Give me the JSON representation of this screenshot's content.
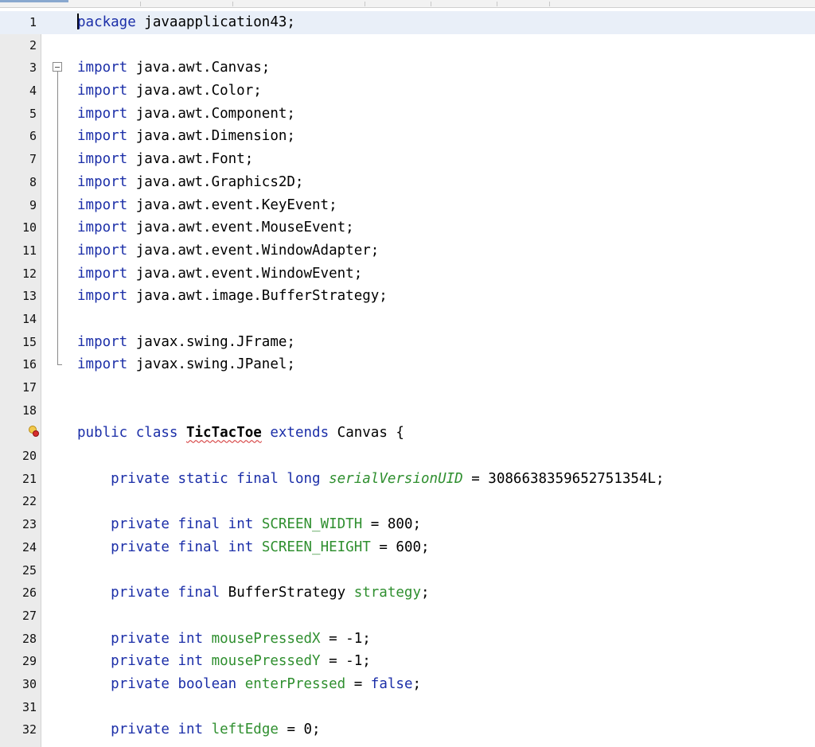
{
  "editor": {
    "lines": [
      {
        "n": "1",
        "parts": [
          {
            "t": "package",
            "c": "kw"
          },
          {
            "t": " javaapplication43;",
            "c": ""
          }
        ]
      },
      {
        "n": "2",
        "parts": []
      },
      {
        "n": "3",
        "parts": [
          {
            "t": "import",
            "c": "kw"
          },
          {
            "t": " java.awt.Canvas;",
            "c": ""
          }
        ]
      },
      {
        "n": "4",
        "parts": [
          {
            "t": "import",
            "c": "kw"
          },
          {
            "t": " java.awt.Color;",
            "c": ""
          }
        ]
      },
      {
        "n": "5",
        "parts": [
          {
            "t": "import",
            "c": "kw"
          },
          {
            "t": " java.awt.Component;",
            "c": ""
          }
        ]
      },
      {
        "n": "6",
        "parts": [
          {
            "t": "import",
            "c": "kw"
          },
          {
            "t": " java.awt.Dimension;",
            "c": ""
          }
        ]
      },
      {
        "n": "7",
        "parts": [
          {
            "t": "import",
            "c": "kw"
          },
          {
            "t": " java.awt.Font;",
            "c": ""
          }
        ]
      },
      {
        "n": "8",
        "parts": [
          {
            "t": "import",
            "c": "kw"
          },
          {
            "t": " java.awt.Graphics2D;",
            "c": ""
          }
        ]
      },
      {
        "n": "9",
        "parts": [
          {
            "t": "import",
            "c": "kw"
          },
          {
            "t": " java.awt.event.KeyEvent;",
            "c": ""
          }
        ]
      },
      {
        "n": "10",
        "parts": [
          {
            "t": "import",
            "c": "kw"
          },
          {
            "t": " java.awt.event.MouseEvent;",
            "c": ""
          }
        ]
      },
      {
        "n": "11",
        "parts": [
          {
            "t": "import",
            "c": "kw"
          },
          {
            "t": " java.awt.event.WindowAdapter;",
            "c": ""
          }
        ]
      },
      {
        "n": "12",
        "parts": [
          {
            "t": "import",
            "c": "kw"
          },
          {
            "t": " java.awt.event.WindowEvent;",
            "c": ""
          }
        ]
      },
      {
        "n": "13",
        "parts": [
          {
            "t": "import",
            "c": "kw"
          },
          {
            "t": " java.awt.image.BufferStrategy;",
            "c": ""
          }
        ]
      },
      {
        "n": "14",
        "parts": []
      },
      {
        "n": "15",
        "parts": [
          {
            "t": "import",
            "c": "kw"
          },
          {
            "t": " javax.swing.JFrame;",
            "c": ""
          }
        ]
      },
      {
        "n": "16",
        "parts": [
          {
            "t": "import",
            "c": "kw"
          },
          {
            "t": " javax.swing.JPanel;",
            "c": ""
          }
        ]
      },
      {
        "n": "17",
        "parts": []
      },
      {
        "n": "18",
        "parts": []
      },
      {
        "n": "",
        "icon": "warning-error-bulb-icon",
        "parts": [
          {
            "t": "public class",
            "c": "kw"
          },
          {
            "t": " ",
            "c": ""
          },
          {
            "t": "TicTacToe",
            "c": "cls-name"
          },
          {
            "t": " ",
            "c": ""
          },
          {
            "t": "extends",
            "c": "kw"
          },
          {
            "t": " Canvas {",
            "c": ""
          }
        ]
      },
      {
        "n": "20",
        "parts": []
      },
      {
        "n": "21",
        "parts": [
          {
            "t": "    ",
            "c": ""
          },
          {
            "t": "private static final long",
            "c": "kw"
          },
          {
            "t": " ",
            "c": ""
          },
          {
            "t": "serialVersionUID",
            "c": "fld-i"
          },
          {
            "t": " = 3086638359652751354L;",
            "c": ""
          }
        ]
      },
      {
        "n": "22",
        "parts": []
      },
      {
        "n": "23",
        "parts": [
          {
            "t": "    ",
            "c": ""
          },
          {
            "t": "private final int",
            "c": "kw"
          },
          {
            "t": " ",
            "c": ""
          },
          {
            "t": "SCREEN_WIDTH",
            "c": "fld"
          },
          {
            "t": " = 800;",
            "c": ""
          }
        ]
      },
      {
        "n": "24",
        "parts": [
          {
            "t": "    ",
            "c": ""
          },
          {
            "t": "private final int",
            "c": "kw"
          },
          {
            "t": " ",
            "c": ""
          },
          {
            "t": "SCREEN_HEIGHT",
            "c": "fld"
          },
          {
            "t": " = 600;",
            "c": ""
          }
        ]
      },
      {
        "n": "25",
        "parts": []
      },
      {
        "n": "26",
        "parts": [
          {
            "t": "    ",
            "c": ""
          },
          {
            "t": "private final",
            "c": "kw"
          },
          {
            "t": " BufferStrategy ",
            "c": ""
          },
          {
            "t": "strategy",
            "c": "fld"
          },
          {
            "t": ";",
            "c": ""
          }
        ]
      },
      {
        "n": "27",
        "parts": []
      },
      {
        "n": "28",
        "parts": [
          {
            "t": "    ",
            "c": ""
          },
          {
            "t": "private int",
            "c": "kw"
          },
          {
            "t": " ",
            "c": ""
          },
          {
            "t": "mousePressedX",
            "c": "fld"
          },
          {
            "t": " = -1;",
            "c": ""
          }
        ]
      },
      {
        "n": "29",
        "parts": [
          {
            "t": "    ",
            "c": ""
          },
          {
            "t": "private int",
            "c": "kw"
          },
          {
            "t": " ",
            "c": ""
          },
          {
            "t": "mousePressedY",
            "c": "fld"
          },
          {
            "t": " = -1;",
            "c": ""
          }
        ]
      },
      {
        "n": "30",
        "parts": [
          {
            "t": "    ",
            "c": ""
          },
          {
            "t": "private boolean",
            "c": "kw"
          },
          {
            "t": " ",
            "c": ""
          },
          {
            "t": "enterPressed",
            "c": "fld"
          },
          {
            "t": " = ",
            "c": ""
          },
          {
            "t": "false",
            "c": "kw"
          },
          {
            "t": ";",
            "c": ""
          }
        ]
      },
      {
        "n": "31",
        "parts": []
      },
      {
        "n": "32",
        "parts": [
          {
            "t": "    ",
            "c": ""
          },
          {
            "t": "private int",
            "c": "kw"
          },
          {
            "t": " ",
            "c": ""
          },
          {
            "t": "leftEdge",
            "c": "fld"
          },
          {
            "t": " = 0;",
            "c": ""
          }
        ]
      }
    ],
    "current_line": "1",
    "fold_icon": "fold-collapse-icon"
  },
  "colors": {
    "keyword": "#1b2ea8",
    "field": "#2f8f2f",
    "gutter_bg": "#ebebeb",
    "current_line_bg": "#e9eff8",
    "error_underline": "#d12b2b"
  }
}
